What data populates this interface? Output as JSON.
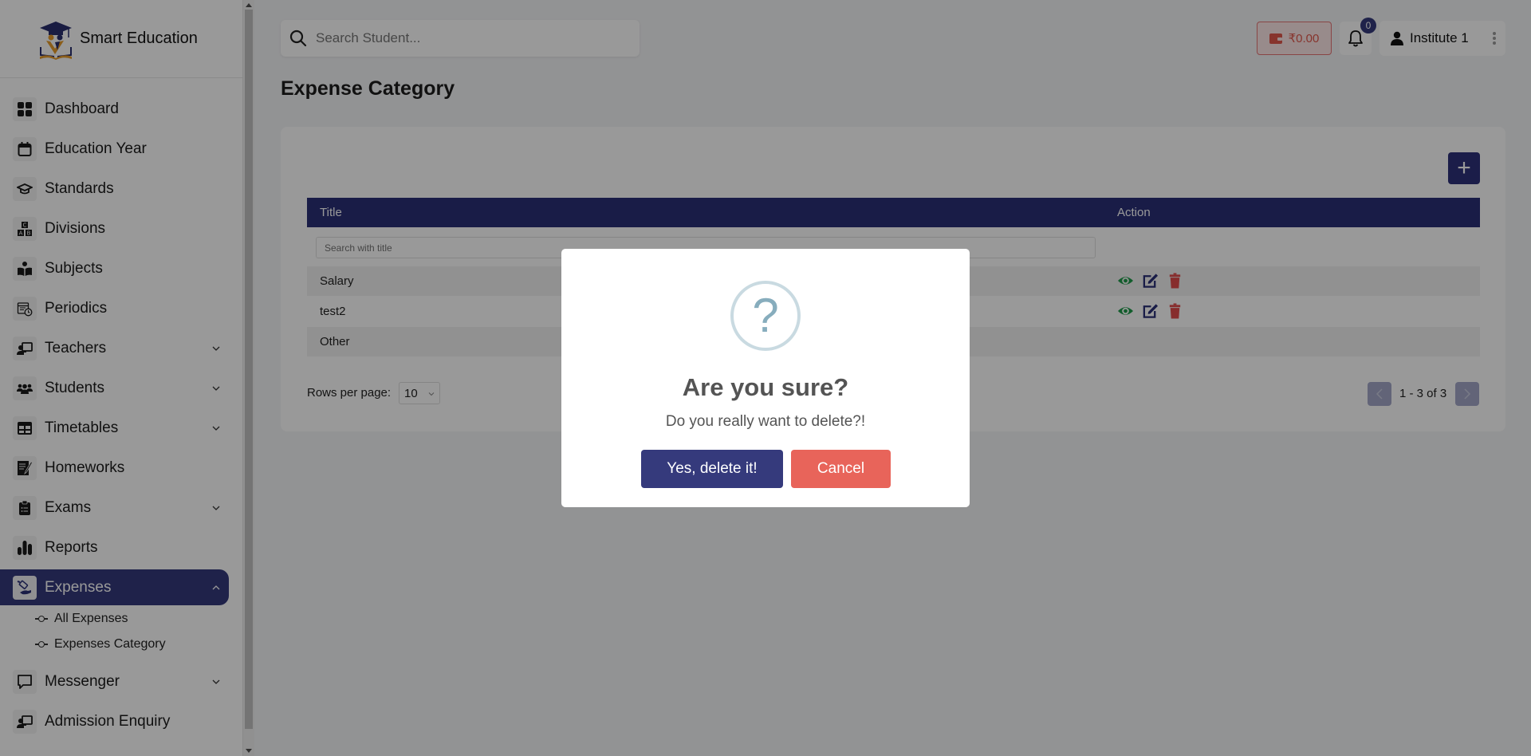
{
  "brand": {
    "name": "Smart Education"
  },
  "sidebar": {
    "items": [
      {
        "label": "Dashboard",
        "icon": "dashboard-icon",
        "expandable": false
      },
      {
        "label": "Education Year",
        "icon": "calendar-icon",
        "expandable": false
      },
      {
        "label": "Standards",
        "icon": "graduation-cap-icon",
        "expandable": false
      },
      {
        "label": "Divisions",
        "icon": "abc-blocks-icon",
        "expandable": false
      },
      {
        "label": "Subjects",
        "icon": "reader-icon",
        "expandable": false
      },
      {
        "label": "Periodics",
        "icon": "calendar-clock-icon",
        "expandable": false
      },
      {
        "label": "Teachers",
        "icon": "teacher-icon",
        "expandable": true
      },
      {
        "label": "Students",
        "icon": "students-icon",
        "expandable": true
      },
      {
        "label": "Timetables",
        "icon": "table-icon",
        "expandable": true
      },
      {
        "label": "Homeworks",
        "icon": "homework-icon",
        "expandable": false
      },
      {
        "label": "Exams",
        "icon": "clipboard-icon",
        "expandable": true
      },
      {
        "label": "Reports",
        "icon": "bar-chart-icon",
        "expandable": false
      },
      {
        "label": "Expenses",
        "icon": "expense-hand-icon",
        "expandable": true,
        "active": true
      },
      {
        "label": "Messenger",
        "icon": "message-icon",
        "expandable": true
      },
      {
        "label": "Admission Enquiry",
        "icon": "teacher-icon",
        "expandable": false
      }
    ],
    "expenses_sub": [
      {
        "label": "All Expenses"
      },
      {
        "label": "Expenses Category"
      }
    ]
  },
  "topbar": {
    "search_placeholder": "Search Student...",
    "wallet_amount": "₹0.00",
    "notification_count": "0",
    "user_name": "Institute 1"
  },
  "page": {
    "title": "Expense Category",
    "add_button": "+",
    "table": {
      "columns": [
        "Title",
        "Action"
      ],
      "filter_placeholder": "Search with title",
      "rows": [
        {
          "title": "Salary",
          "actions": [
            "view",
            "edit",
            "delete"
          ]
        },
        {
          "title": "test2",
          "actions": [
            "view",
            "edit",
            "delete"
          ]
        },
        {
          "title": "Other",
          "actions": []
        }
      ]
    },
    "pagination": {
      "rows_per_page_label": "Rows per page:",
      "rows_per_page": "10",
      "range": "1 - 3 of 3"
    }
  },
  "modal": {
    "icon": "?",
    "title": "Are you sure?",
    "text": "Do you really want to delete?!",
    "confirm_label": "Yes, delete it!",
    "cancel_label": "Cancel"
  },
  "colors": {
    "primary": "#2a2f77",
    "danger": "#e8645a",
    "view": "#1e9c4a"
  }
}
